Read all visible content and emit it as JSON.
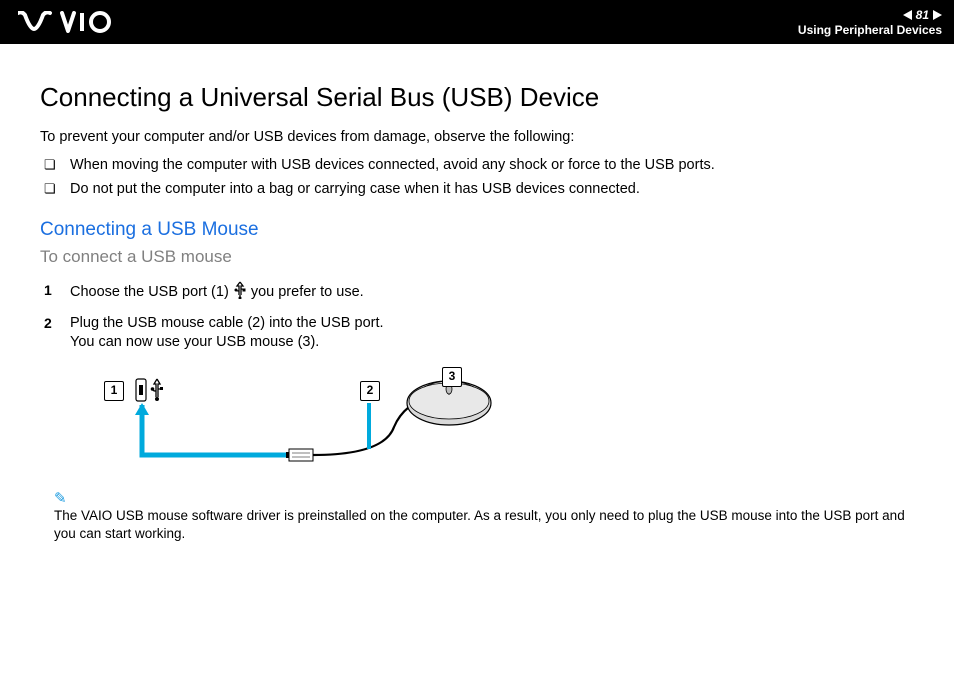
{
  "header": {
    "page_number": "81",
    "section": "Using Peripheral Devices"
  },
  "main": {
    "title": "Connecting a Universal Serial Bus (USB) Device",
    "intro": "To prevent your computer and/or USB devices from damage, observe the following:",
    "bullets": [
      "When moving the computer with USB devices connected, avoid any shock or force to the USB ports.",
      "Do not put the computer into a bag or carrying case when it has USB devices connected."
    ],
    "subheading": "Connecting a USB Mouse",
    "task_title": "To connect a USB mouse",
    "steps": {
      "s1a": "Choose the USB port (1) ",
      "s1b": " you prefer to use.",
      "s2a": "Plug the USB mouse cable (2) into the USB port.",
      "s2b": "You can now use your USB mouse (3)."
    },
    "callouts": {
      "c1": "1",
      "c2": "2",
      "c3": "3"
    },
    "note": "The VAIO USB mouse software driver is preinstalled on the computer. As a result, you only need to plug the USB mouse into the USB port and you can start working."
  }
}
